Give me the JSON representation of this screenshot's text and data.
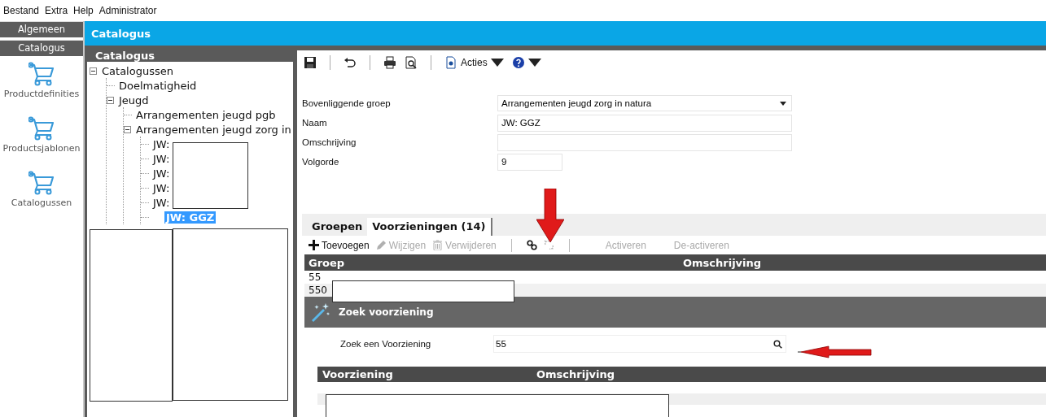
{
  "menu": [
    {
      "label": "Bestand"
    },
    {
      "label": "Extra"
    },
    {
      "label": "Help"
    },
    {
      "label": "Administrator"
    }
  ],
  "nav": {
    "sections": [
      {
        "label": "Algemeen"
      },
      {
        "label": "Catalogus"
      }
    ],
    "items": [
      {
        "label": "Productdefinities"
      },
      {
        "label": "Productsjablonen"
      },
      {
        "label": "Catalogussen"
      }
    ]
  },
  "header": {
    "title": "Catalogus"
  },
  "tree": {
    "title": "Catalogus",
    "items": [
      {
        "label": "Catalogussen",
        "expanded": true,
        "selected": false,
        "children": [
          {
            "label": "Doelmatigheid",
            "selected": false
          },
          {
            "label": "Jeugd",
            "expanded": true,
            "selected": false,
            "children": [
              {
                "label": "Arrangementen jeugd pgb",
                "selected": false
              },
              {
                "label": "Arrangementen jeugd zorg in",
                "expanded": true,
                "selected": false,
                "children": [
                  {
                    "label": "JW:",
                    "selected": false
                  },
                  {
                    "label": "JW:",
                    "selected": false
                  },
                  {
                    "label": "JW:",
                    "selected": false
                  },
                  {
                    "label": "JW:",
                    "selected": false
                  },
                  {
                    "label": "JW:",
                    "selected": false
                  },
                  {
                    "label": "JW: GGZ",
                    "selected": true
                  }
                ]
              }
            ]
          }
        ]
      }
    ]
  },
  "toolbar": [
    {
      "kind": "save"
    },
    {
      "kind": "separator"
    },
    {
      "kind": "undo"
    },
    {
      "kind": "separator"
    },
    {
      "kind": "print"
    },
    {
      "kind": "preview"
    },
    {
      "kind": "separator"
    },
    {
      "kind": "actions",
      "label": "Acties"
    },
    {
      "kind": "help"
    }
  ],
  "form": [
    {
      "label": "Bovenliggende groep",
      "kind": "select",
      "value": "Arrangementen jeugd zorg in natura"
    },
    {
      "label": "Naam",
      "kind": "text",
      "value": "JW: GGZ"
    },
    {
      "label": "Omschrijving",
      "kind": "text"
    },
    {
      "label": "Volgorde",
      "kind": "short",
      "value": "9"
    }
  ],
  "tabs": [
    {
      "label": "Groepen",
      "selected": false
    },
    {
      "label": "Voorzieningen (14)",
      "selected": true
    }
  ],
  "actions": [
    {
      "kind": "add",
      "label": "Toevoegen",
      "disabled": false
    },
    {
      "kind": "edit",
      "label": "Wijzigen",
      "disabled": true
    },
    {
      "kind": "delete",
      "label": "Verwijderen",
      "disabled": true
    },
    {
      "kind": "separator"
    },
    {
      "kind": "link",
      "disabled": false
    },
    {
      "kind": "unlink",
      "disabled": true
    },
    {
      "kind": "separator"
    },
    {
      "kind": "text",
      "label": "Activeren",
      "disabled": true
    },
    {
      "kind": "text",
      "label": "De-activeren",
      "disabled": true
    }
  ],
  "grid": {
    "columns": [
      "Groep",
      "Omschrijving"
    ],
    "rows": [
      [
        "55"
      ],
      [
        "550"
      ]
    ]
  },
  "search_dialog": {
    "title": "Zoek voorziening",
    "field_label": "Zoek een Voorziening",
    "value": "55",
    "columns": [
      "Voorziening",
      "Omschrijving"
    ]
  }
}
